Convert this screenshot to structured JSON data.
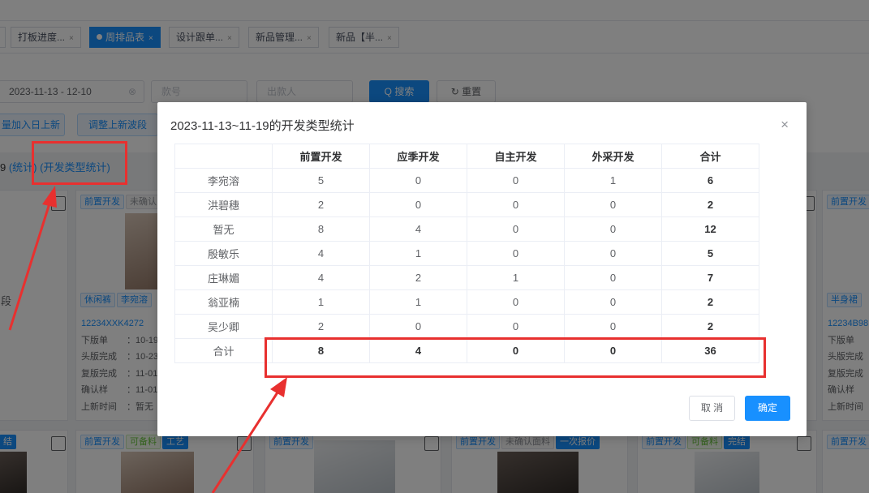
{
  "tabs": [
    {
      "label": "打板进度...",
      "close": "×",
      "active": false
    },
    {
      "label": "周排品表",
      "close": "×",
      "active": true
    },
    {
      "label": "设计跟单...",
      "close": "×",
      "active": false
    },
    {
      "label": "新品管理...",
      "close": "×",
      "active": false
    },
    {
      "label": "新品【半...",
      "close": "×",
      "active": false
    }
  ],
  "filters": {
    "date_range": "2023-11-13  -  12-10",
    "date_clear": "⊗",
    "style_placeholder": "款号",
    "producer_placeholder": "出款人",
    "search_label": "Q 搜索",
    "reset_label": "↻ 重置",
    "batch_add_label": "量加入日上新",
    "adjust_wave_label": "调整上新波段"
  },
  "stat_line": {
    "prefix": "9 ",
    "stat_link": "(统计)",
    "dev_type_link": "(开发类型统计)"
  },
  "cards": {
    "left_edge_label": "段",
    "left_bottom_tag": "结",
    "card1": {
      "tags": [
        "前置开发",
        "未确认"
      ],
      "bottom_tags": [
        "休闲裤",
        "李宛溶"
      ],
      "code": "12234XXK4272",
      "rows": [
        {
          "k": "下版单",
          "v": "：10-19"
        },
        {
          "k": "头版完成",
          "v": "：10-23"
        },
        {
          "k": "复版完成",
          "v": "：11-01"
        },
        {
          "k": "确认样",
          "v": "：11-01"
        },
        {
          "k": "上新时间",
          "v": "：暂无"
        }
      ]
    },
    "card_right": {
      "tag": "前置开发",
      "bottom_tag": "半身裙",
      "code": "12234B98",
      "rows": [
        "下版单",
        "头版完成",
        "复版完成",
        "确认样",
        "上新时间"
      ]
    },
    "row2_tags": [
      [
        "前置开发",
        "可备料",
        "工艺"
      ],
      [
        "前置开发"
      ],
      [
        "前置开发",
        "未确认面料",
        "一次报价"
      ],
      [
        "前置开发",
        "可备料",
        "完结"
      ],
      [
        "前置开发"
      ]
    ]
  },
  "modal": {
    "title": "2023-11-13~11-19的开发类型统计",
    "close_icon": "×",
    "columns": [
      "",
      "前置开发",
      "应季开发",
      "自主开发",
      "外采开发",
      "合计"
    ],
    "rows": [
      {
        "name": "李宛溶",
        "values": [
          "5",
          "0",
          "0",
          "1",
          "6"
        ]
      },
      {
        "name": "洪碧穗",
        "values": [
          "2",
          "0",
          "0",
          "0",
          "2"
        ]
      },
      {
        "name": "暂无",
        "values": [
          "8",
          "4",
          "0",
          "0",
          "12"
        ]
      },
      {
        "name": "殷敏乐",
        "values": [
          "4",
          "1",
          "0",
          "0",
          "5"
        ]
      },
      {
        "name": "庄琳媚",
        "values": [
          "4",
          "2",
          "1",
          "0",
          "7"
        ]
      },
      {
        "name": "翁亚楠",
        "values": [
          "1",
          "1",
          "0",
          "0",
          "2"
        ]
      },
      {
        "name": "吴少卿",
        "values": [
          "2",
          "0",
          "0",
          "0",
          "2"
        ]
      }
    ],
    "total_row": {
      "name": "合计",
      "values": [
        "8",
        "4",
        "0",
        "0",
        "36"
      ]
    },
    "cancel_label": "取 消",
    "ok_label": "确定"
  },
  "colors": {
    "primary": "#1890ff",
    "annotation_red": "#e8302f",
    "mask": "rgba(0,0,0,0.5)"
  }
}
